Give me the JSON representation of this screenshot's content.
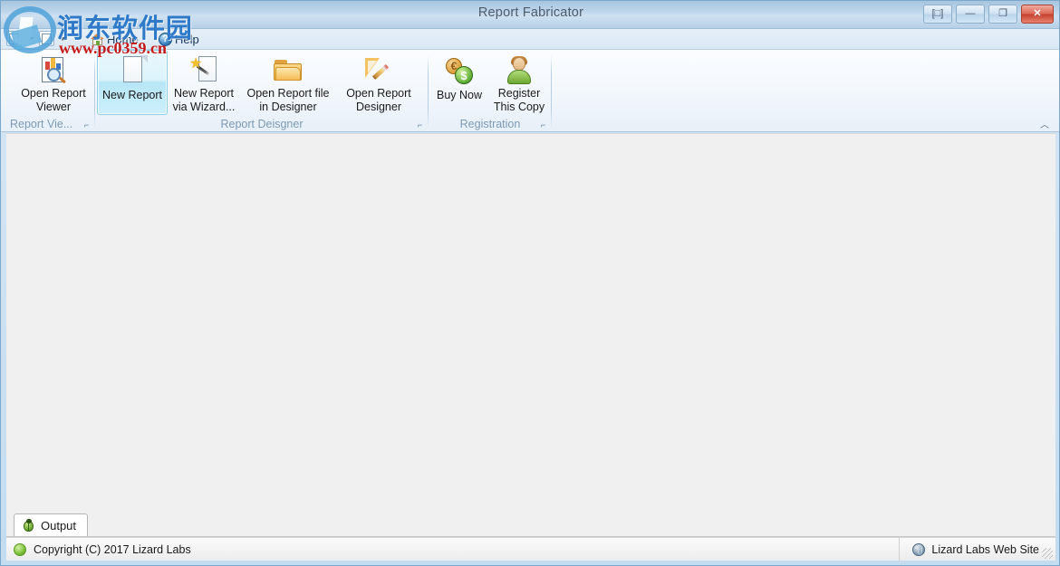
{
  "window": {
    "title": "Report Fabricator",
    "buttons": [
      {
        "name": "restore-down-button",
        "glyph": "[□]"
      },
      {
        "name": "minimize-button",
        "glyph": "—"
      },
      {
        "name": "maximize-button",
        "glyph": "❐"
      },
      {
        "name": "close-button",
        "glyph": "✕"
      }
    ]
  },
  "quick_access": {
    "icon": "document-icon",
    "dropdown_icon": "chevron-down-icon"
  },
  "tabs": [
    {
      "label": "Home",
      "icon": "home-icon"
    },
    {
      "label": "Help",
      "icon": "help-icon"
    }
  ],
  "ribbon": {
    "collapse_icon": "chevron-up-icon",
    "dialog_launcher_glyph": "⌐",
    "groups": [
      {
        "label": "Report Vie...",
        "name": "report-viewer-group",
        "has_dialog_launcher": true,
        "buttons": [
          {
            "label": "Open Report\nViewer",
            "icon": "report-viewer-icon",
            "selected": false
          }
        ]
      },
      {
        "label": "Report Deisgner",
        "name": "report-designer-group",
        "has_dialog_launcher": true,
        "buttons": [
          {
            "label": "New Report",
            "icon": "new-page-icon",
            "selected": true
          },
          {
            "label": "New Report\nvia Wizard...",
            "icon": "new-page-wizard-icon",
            "selected": false
          },
          {
            "label": "Open Report file\nin Designer",
            "icon": "folder-open-icon",
            "selected": false
          },
          {
            "label": "Open Report\nDesigner",
            "icon": "ruler-pencil-icon",
            "selected": false
          }
        ]
      },
      {
        "label": "Registration",
        "name": "registration-group",
        "has_dialog_launcher": true,
        "buttons": [
          {
            "label": "Buy Now",
            "icon": "coins-icon",
            "selected": false
          },
          {
            "label": "Register\nThis Copy",
            "icon": "user-icon",
            "selected": false
          }
        ]
      }
    ]
  },
  "output_dock": {
    "tab_label": "Output",
    "tab_icon": "bug-icon"
  },
  "status_bar": {
    "led_icon": "status-led-icon",
    "copyright": "Copyright (C) 2017 Lizard Labs",
    "link_icon": "globe-icon",
    "link_label": "Lizard Labs Web Site"
  },
  "watermark": {
    "chinese_text": "润东软件园",
    "url_text": "www.pc0359.cn"
  },
  "colors": {
    "title_bar_blue": "#bdd5ea",
    "selected_button": "#b7e6f6",
    "group_label": "#7d9ab4",
    "close_red": "#c4412e",
    "watermark_blue": "#2f79c9",
    "watermark_red": "#c41a1a"
  }
}
